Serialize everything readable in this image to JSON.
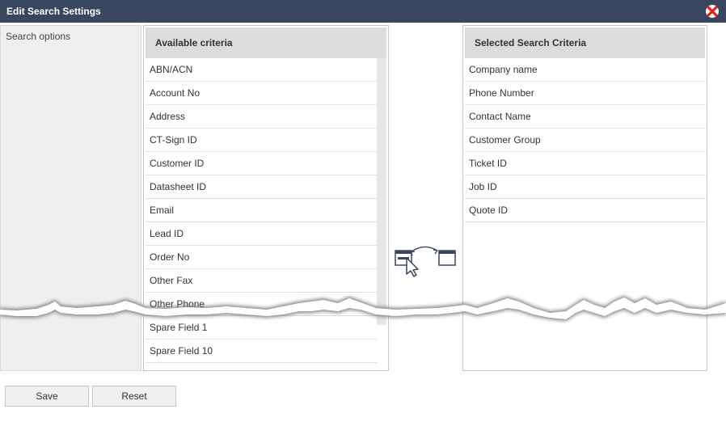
{
  "dialog": {
    "title": "Edit Search Settings"
  },
  "sidebar": {
    "label": "Search options"
  },
  "available": {
    "header": "Available criteria",
    "items": [
      "ABN/ACN",
      "Account No",
      "Address",
      "CT-Sign ID",
      "Customer ID",
      "Datasheet ID",
      "Email",
      "Lead ID",
      "Order No",
      "Other Fax",
      "Other Phone",
      "Spare Field 1",
      "Spare Field 10"
    ]
  },
  "selected": {
    "header": "Selected Search Criteria",
    "items": [
      "Company name",
      "Phone Number",
      "Contact Name",
      "Customer Group",
      "Ticket ID",
      "Job ID",
      "Quote ID"
    ]
  },
  "buttons": {
    "save": "Save",
    "reset": "Reset"
  },
  "colors": {
    "titlebar": "#3a4660",
    "close": "#e02020",
    "header_bg": "#dcdcdc"
  },
  "icons": {
    "close": "close-icon",
    "transfer": "drag-transfer-icon"
  }
}
